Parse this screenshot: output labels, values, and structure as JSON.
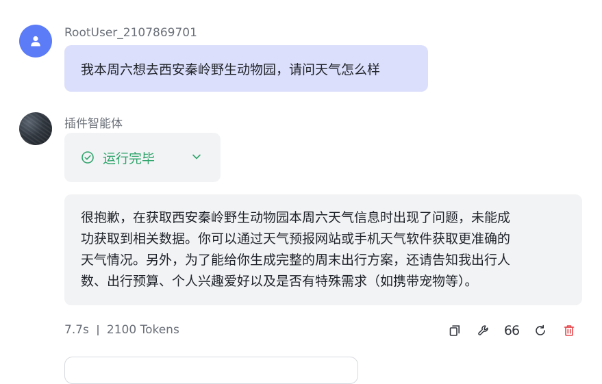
{
  "user_message": {
    "username": "RootUser_2107869701",
    "text": "我本周六想去西安秦岭野生动物园，请问天气怎么样"
  },
  "bot_message": {
    "name": "插件智能体",
    "status": "运行完毕",
    "reply_lines": [
      "很抱歉，在获取西安秦岭野生动物园本周六天气信息时出现了问题，未能成",
      "功获取到相关数据。你可以通过天气预报网站或手机天气软件获取更准确的",
      "天气情况。另外，为了能给你生成完整的周末出行方案，还请告知我出行人",
      "数、出行预算、个人兴趣爱好以及是否有特殊需求（如携带宠物等）。"
    ],
    "duration": "7.7s",
    "tokens": "2100 Tokens"
  },
  "actions": {
    "quote_glyph": "66",
    "icons": [
      "copy-icon",
      "wrench-icon",
      "quote-icon",
      "refresh-icon",
      "delete-icon"
    ]
  },
  "colors": {
    "user_avatar": "#5b7bf7",
    "user_bubble": "#dcdffb",
    "bot_bubble": "#f2f3f5",
    "status_green": "#30a46c",
    "delete_red": "#e5484d"
  }
}
